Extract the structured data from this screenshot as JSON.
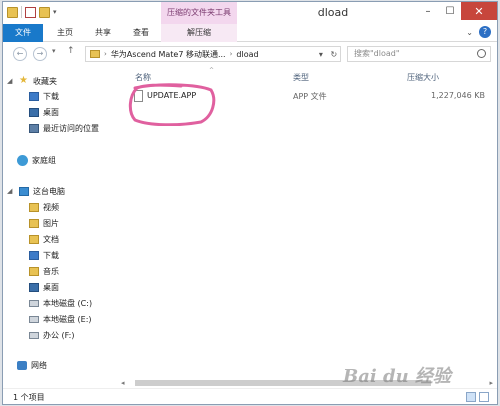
{
  "window": {
    "title": "dload",
    "context_tab_group": "压缩的文件夹工具"
  },
  "ribbon": {
    "tabs": [
      "文件",
      "主页",
      "共享",
      "查看",
      "解压缩"
    ]
  },
  "address_bar": {
    "path": [
      "华为Ascend Mate7 移动联通...",
      "dload"
    ],
    "search_placeholder": "搜索\"dload\""
  },
  "nav_pane": {
    "favorites": {
      "label": "收藏夹",
      "items": [
        "下载",
        "桌面",
        "最近访问的位置"
      ]
    },
    "homegroup": "家庭组",
    "this_pc": {
      "label": "这台电脑",
      "items": [
        "视频",
        "图片",
        "文档",
        "下载",
        "音乐",
        "桌面",
        "本地磁盘 (C:)",
        "本地磁盘 (E:)",
        "办公 (F:)"
      ]
    },
    "network": "网络"
  },
  "file_list": {
    "columns": {
      "name": "名称",
      "type": "类型",
      "size": "压缩大小"
    },
    "rows": [
      {
        "name": "UPDATE.APP",
        "type": "APP 文件",
        "size": "1,227,046 KB"
      }
    ]
  },
  "status_bar": {
    "item_count": "1 个项目"
  },
  "watermark": "Bai du 经验",
  "annotation": {
    "color": "#e0609f"
  }
}
